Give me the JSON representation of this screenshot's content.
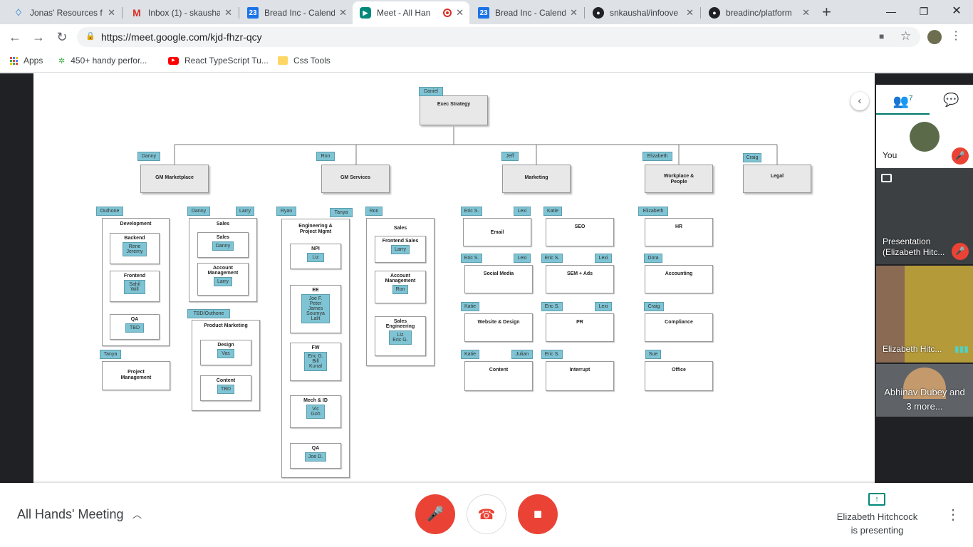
{
  "browser": {
    "tabs": [
      {
        "title": "Jonas' Resources f",
        "icon": "gem-icon",
        "color": "#4a90d9"
      },
      {
        "title": "Inbox (1) - skausha",
        "icon": "gmail-icon",
        "color": "#d93025"
      },
      {
        "title": "Bread Inc - Calend",
        "icon": "calendar-icon",
        "color": "#1a73e8"
      },
      {
        "title": "Meet - All Han",
        "icon": "meet-icon",
        "color": "#00897b"
      },
      {
        "title": "Bread Inc - Calend",
        "icon": "calendar-icon",
        "color": "#1a73e8"
      },
      {
        "title": "snkaushal/infoove",
        "icon": "github-icon",
        "color": "#202124"
      },
      {
        "title": "breadinc/platform",
        "icon": "github-icon",
        "color": "#202124"
      }
    ],
    "calendar_badge": "23",
    "url": "https://meet.google.com/kjd-fhzr-qcy",
    "bookmarks": [
      {
        "label": "Apps",
        "icon": "apps-grid-icon"
      },
      {
        "label": "450+ handy perfor...",
        "icon": "site-icon"
      },
      {
        "label": "React TypeScript Tu...",
        "icon": "youtube-icon"
      },
      {
        "label": "Css Tools",
        "icon": "folder-icon"
      }
    ]
  },
  "org": {
    "exec": {
      "title": "Exec Strategy",
      "name": "Daniel"
    },
    "depts": [
      {
        "title": "GM Marketplace",
        "name": "Danny"
      },
      {
        "title": "GM Services",
        "name": "Ron"
      },
      {
        "title": "Marketing",
        "name": "Jeff"
      },
      {
        "title": "Workplace &\nPeople",
        "name": "Elizabeth"
      },
      {
        "title": "Legal",
        "name": "Craig"
      }
    ],
    "marketplace": {
      "development": {
        "title": "Development",
        "name": "Outhone"
      },
      "backend": {
        "title": "Backend",
        "names": "Rene\nJeremy"
      },
      "frontend": {
        "title": "Frontend",
        "names": "Sahil\nWill"
      },
      "qa": {
        "title": "QA",
        "names": "TBD"
      },
      "project": {
        "title": "Project\nManagement",
        "name": "Tanya"
      },
      "sales": {
        "title": "Sales",
        "name1": "Danny",
        "name2": "Larry"
      },
      "sales_sub": {
        "title": "Sales",
        "names": "Danny"
      },
      "account": {
        "title": "Account\nManagement",
        "names": "Larry"
      },
      "product": {
        "title": "Product Marketing",
        "name": "TBD/Outhone"
      },
      "design": {
        "title": "Design",
        "names": "Vas"
      },
      "content": {
        "title": "Content",
        "names": "TBD"
      }
    },
    "services": {
      "eng": {
        "title": "Engineering &\nProject Mgmt",
        "name1": "Ryan",
        "name2": "Tanya"
      },
      "npi": {
        "title": "NPI",
        "names": "Liz"
      },
      "ee": {
        "title": "EE",
        "names": "Joe F.\nPeter\nJames\nSoumya\nLalit"
      },
      "fw": {
        "title": "FW",
        "names": "Eric G.\nBill\nKunal"
      },
      "mech": {
        "title": "Mech & ID",
        "names": "Vic\nGoh"
      },
      "qa": {
        "title": "QA",
        "names": "Joe D."
      },
      "sales": {
        "title": "Sales",
        "name": "Ron"
      },
      "frontend_sales": {
        "title": "Frontend Sales",
        "names": "Larry"
      },
      "account": {
        "title": "Account\nManagement",
        "names": "Ron"
      },
      "sales_eng": {
        "title": "Sales\nEngineering",
        "names": "Liz\nEric G."
      }
    },
    "marketing": [
      {
        "title": "Email",
        "a": "Eric S.",
        "b": "Lexi"
      },
      {
        "title": "SEO",
        "a": "Katie",
        "b": ""
      },
      {
        "title": "Social Media",
        "a": "Eric S.",
        "b": "Lexi"
      },
      {
        "title": "SEM + Ads",
        "a": "Eric S.",
        "b": "Lexi"
      },
      {
        "title": "Website & Design",
        "a": "Katie",
        "b": ""
      },
      {
        "title": "PR",
        "a": "Eric S.",
        "b": "Lexi"
      },
      {
        "title": "Content",
        "a": "Katie",
        "b": "Julian"
      },
      {
        "title": "Interrupt",
        "a": "Eric S.",
        "b": ""
      }
    ],
    "people": [
      {
        "title": "HR",
        "name": "Elizabeth"
      },
      {
        "title": "Accounting",
        "name": "Dora"
      },
      {
        "title": "Compliance",
        "name": "Craig"
      },
      {
        "title": "Office",
        "name": "Sue"
      }
    ]
  },
  "sidebar": {
    "people_count": "7",
    "tiles": [
      {
        "label": "You",
        "muted": true
      },
      {
        "label": "Presentation\n(Elizabeth Hitc...",
        "muted": true
      },
      {
        "label": "Elizabeth Hitc...",
        "muted": false
      },
      {
        "label": "Abhinav Dubey and\n3 more...",
        "muted": false
      }
    ]
  },
  "bottom": {
    "meeting_title": "All Hands' Meeting",
    "presenter_name": "Elizabeth Hitchcock",
    "presenter_status": "is presenting",
    "mic_color": "#ea4335",
    "hangup_color": "#ea4335"
  }
}
